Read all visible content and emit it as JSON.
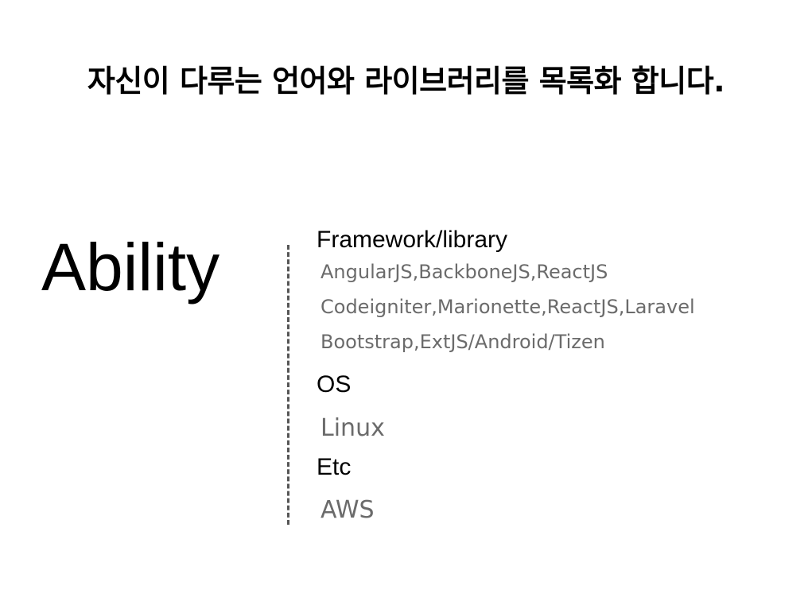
{
  "slide": {
    "title": "자신이 다루는 언어와 라이브러리를 목록화 합니다.",
    "left_label": "Ability"
  },
  "sections": [
    {
      "heading": "Framework/library",
      "items": [
        "AngularJS,BackboneJS,ReactJS",
        "Codeigniter,Marionette,ReactJS,Laravel",
        "Bootstrap,ExtJS/Android/Tizen"
      ]
    },
    {
      "heading": "OS",
      "items": [
        "Linux"
      ]
    },
    {
      "heading": "Etc",
      "items": [
        "AWS"
      ]
    }
  ],
  "colors": {
    "heading": "#000000",
    "item": "#6b6b6b",
    "divider": "#555555",
    "background": "#ffffff"
  }
}
